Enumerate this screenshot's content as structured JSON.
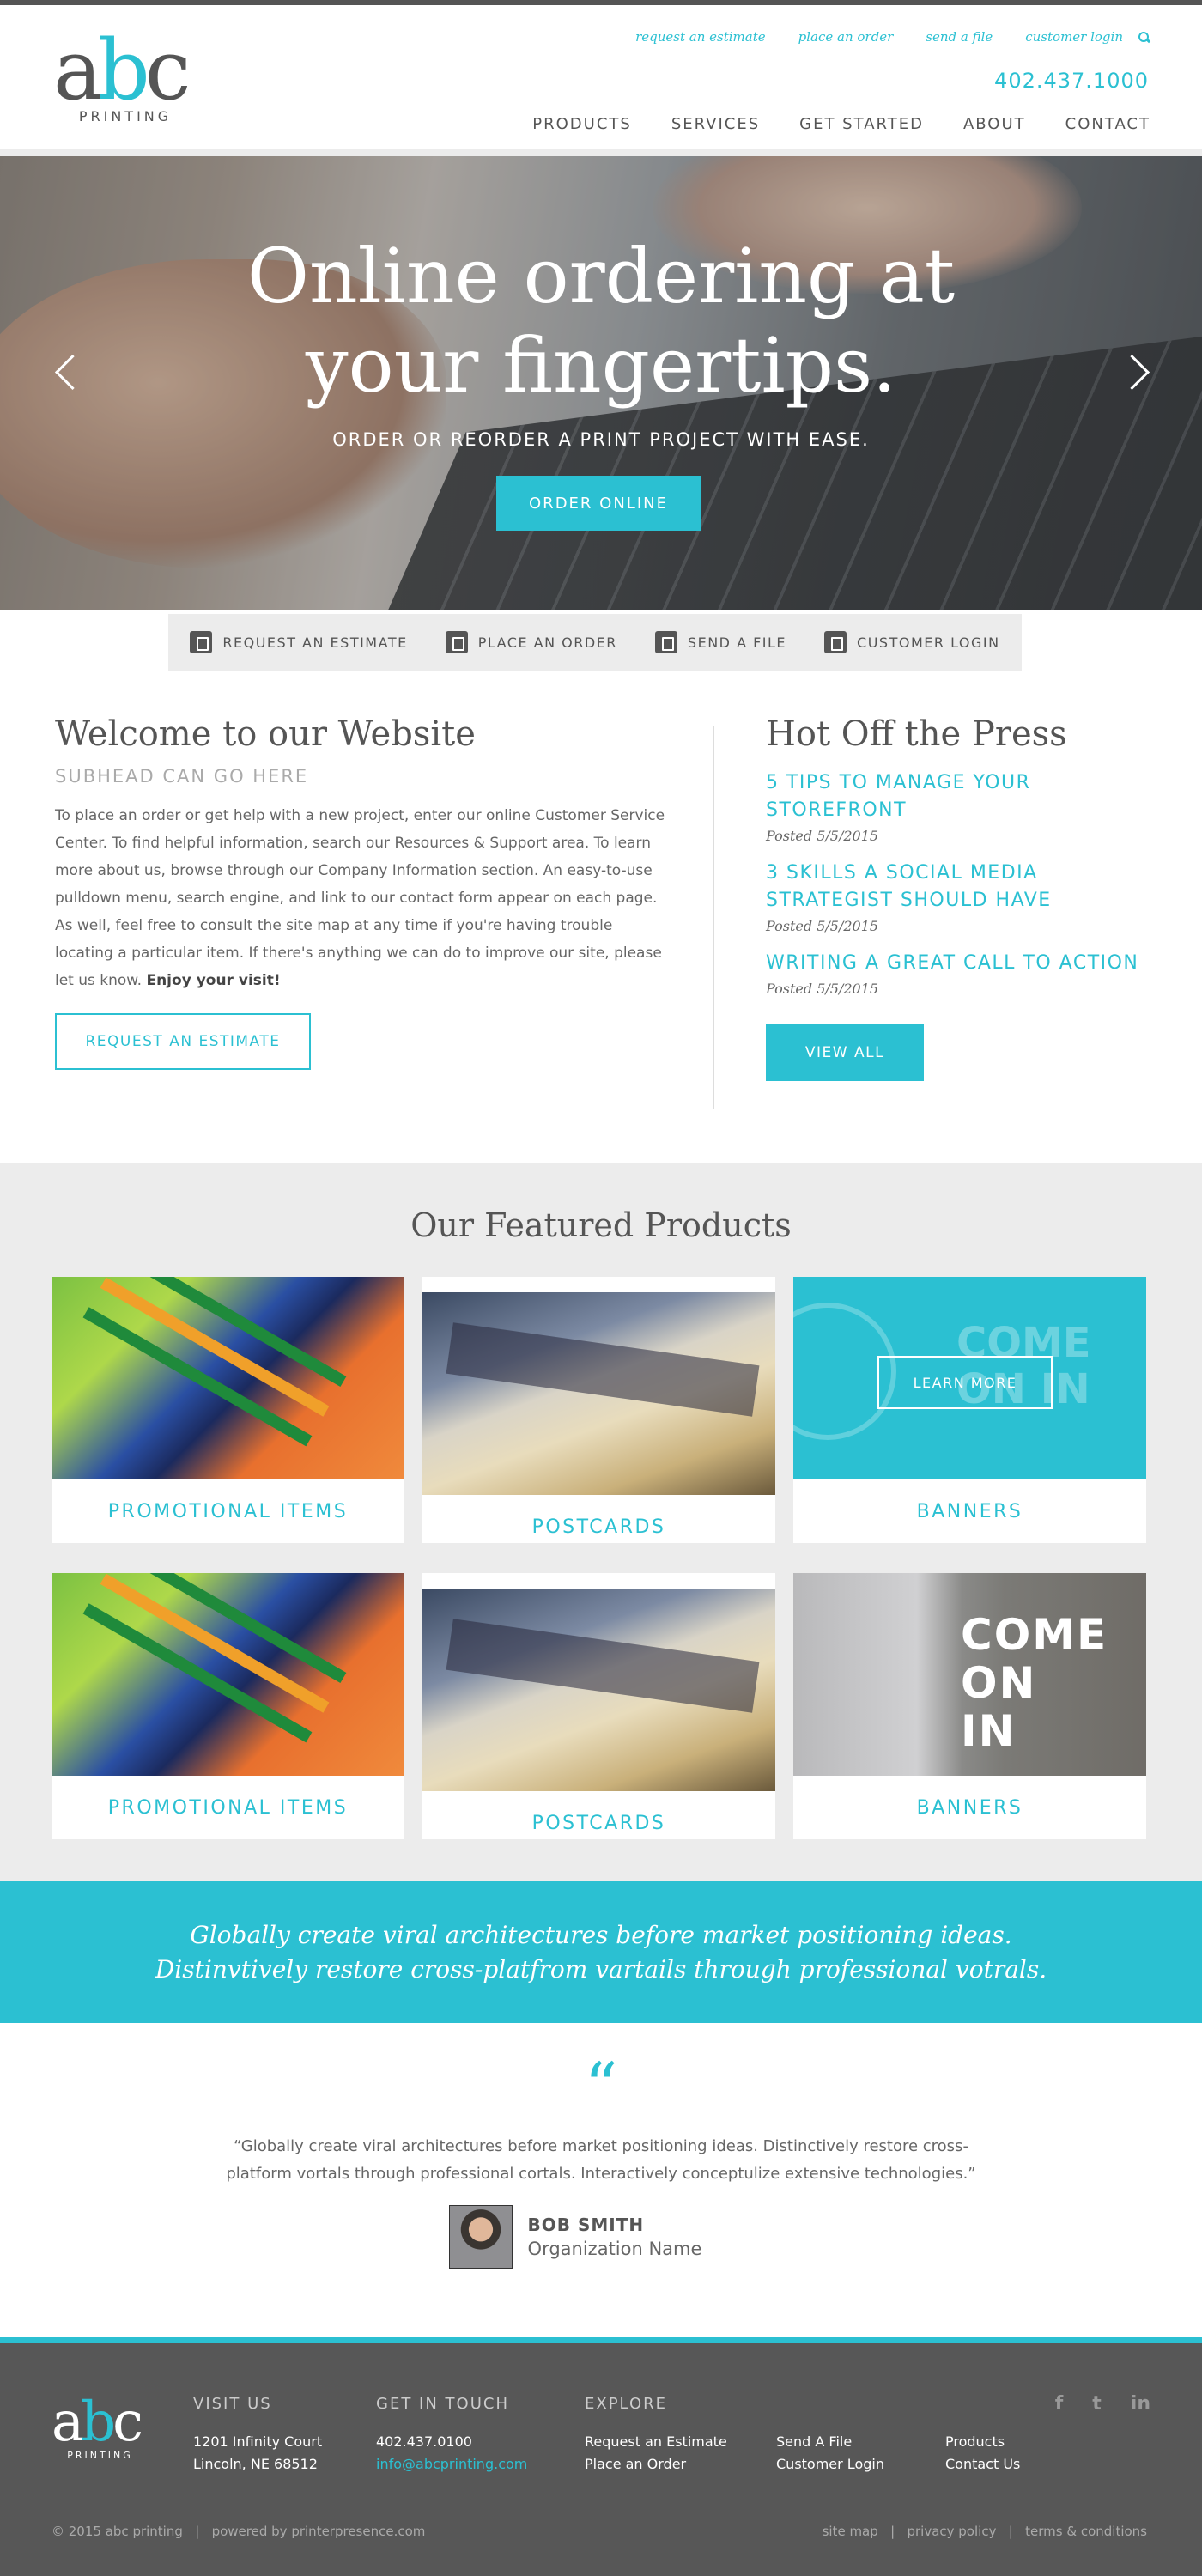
{
  "brand": {
    "logo_letters_a": "a",
    "logo_letters_b": "b",
    "logo_letters_c": "c",
    "logo_sub": "PRINTING",
    "accent": "#2bc0d2",
    "dark": "#575757"
  },
  "utility_nav": [
    "request an estimate",
    "place an order",
    "send a file",
    "customer login"
  ],
  "phone": "402.437.1000",
  "main_nav": [
    "PRODUCTS",
    "SERVICES",
    "GET STARTED",
    "ABOUT",
    "CONTACT"
  ],
  "hero": {
    "title_line1": "Online ordering at",
    "title_line2": "your fingertips.",
    "subtitle": "ORDER OR REORDER A PRINT PROJECT WITH EASE.",
    "button": "ORDER ONLINE"
  },
  "quick_links": [
    {
      "label": "REQUEST AN ESTIMATE",
      "icon": "calculator-icon"
    },
    {
      "label": "PLACE AN ORDER",
      "icon": "cart-icon"
    },
    {
      "label": "SEND A FILE",
      "icon": "folder-icon"
    },
    {
      "label": "CUSTOMER LOGIN",
      "icon": "lock-icon"
    }
  ],
  "welcome": {
    "title": "Welcome to our Website",
    "subhead": "SUBHEAD CAN GO HERE",
    "body": "To place an order or get help with a new project, enter our online Customer Service Center. To find helpful information, search our Resources & Support area. To learn more about us, browse through our Company Information section. An easy-to-use pulldown menu, search engine, and link to our contact form appear on each page. As well, feel free to consult the site map at any time if you're having trouble locating a particular item. If there's anything we can do to improve our site, please let us know. ",
    "body_bold": "Enjoy your visit!",
    "button": "REQUEST AN ESTIMATE"
  },
  "press": {
    "title": "Hot Off the Press",
    "posts": [
      {
        "title": "5 TIPS TO MANAGE YOUR STOREFRONT",
        "date": "Posted 5/5/2015"
      },
      {
        "title": "3 SKILLS A SOCIAL MEDIA STRATEGIST SHOULD HAVE",
        "date": "Posted 5/5/2015"
      },
      {
        "title": "WRITING A GREAT CALL TO ACTION",
        "date": "Posted 5/5/2015"
      }
    ],
    "button": "VIEW ALL"
  },
  "featured": {
    "title": "Our Featured Products",
    "cards": [
      {
        "label": "PROMOTIONAL ITEMS"
      },
      {
        "label": "POSTCARDS"
      },
      {
        "label": "BANNERS",
        "hover_button": "LEARN MORE"
      },
      {
        "label": "PROMOTIONAL ITEMS"
      },
      {
        "label": "POSTCARDS"
      },
      {
        "label": "BANNERS"
      }
    ],
    "banner_sign": "COME ON IN"
  },
  "band_text": "Globally create viral architectures before market positioning ideas. Distinvtively restore cross-platfrom vartails through professional votrals.",
  "testimonial": {
    "mark": "“",
    "quote": "“Globally create viral architectures before market positioning ideas. Distinctively restore cross-platform vortals through professional cortals. Interactively conceptulize extensive technologies.”",
    "name": "BOB SMITH",
    "org": "Organization Name"
  },
  "footer": {
    "visit": {
      "heading": "VISIT US",
      "line1": "1201 Infinity Court",
      "line2": "Lincoln, NE 68512"
    },
    "contact": {
      "heading": "GET IN TOUCH",
      "phone": "402.437.0100",
      "email": "info@abcprinting.com"
    },
    "explore": {
      "heading": "EXPLORE",
      "col1": [
        "Request an Estimate",
        "Place an Order"
      ],
      "col2": [
        "Send A File",
        "Customer Login"
      ],
      "col3": [
        "Products",
        "Contact Us"
      ]
    },
    "social": [
      "f",
      "t",
      "in"
    ],
    "copyright": "© 2015 abc printing",
    "powered_prefix": "powered by",
    "powered_link": "printerpresence.com",
    "legal_links": [
      "site map",
      "privacy policy",
      "terms & conditions"
    ]
  }
}
